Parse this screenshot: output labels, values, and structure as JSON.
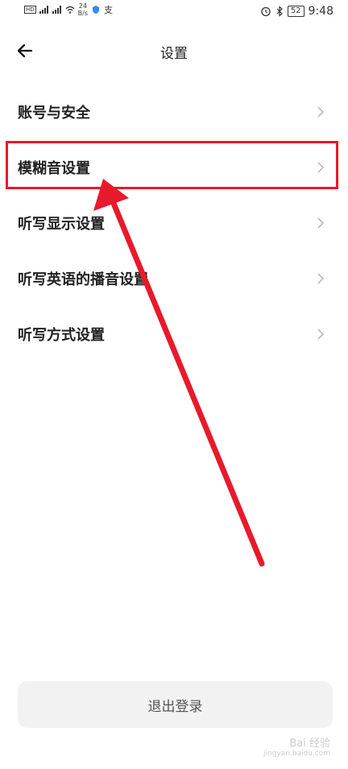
{
  "status_bar": {
    "net_speed": "24",
    "net_unit": "B/s",
    "battery": "52",
    "time": "9:48",
    "hd1": "HD",
    "hd2": "HD"
  },
  "header": {
    "title": "设置"
  },
  "menu": {
    "items": [
      {
        "label": "账号与安全"
      },
      {
        "label": "模糊音设置"
      },
      {
        "label": "听写显示设置"
      },
      {
        "label": "听写英语的播音设置"
      },
      {
        "label": "听写方式设置"
      }
    ]
  },
  "logout": {
    "label": "退出登录"
  },
  "watermark": {
    "text": "Bai 经验",
    "sub": "jingyan.baidu.com"
  },
  "colors": {
    "annotation_red": "#e8192c"
  }
}
